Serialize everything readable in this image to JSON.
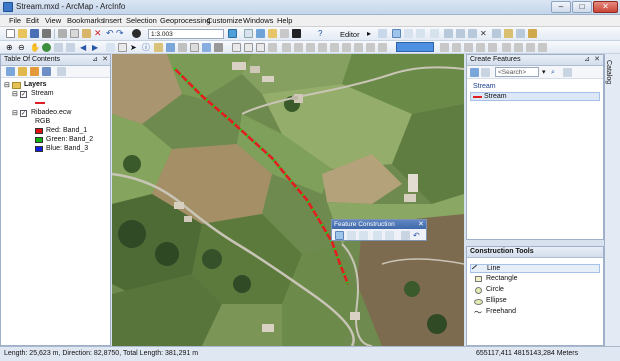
{
  "window": {
    "title": "Stream.mxd - ArcMap - ArcInfo"
  },
  "menu": {
    "items": [
      {
        "label": "File"
      },
      {
        "label": "Edit"
      },
      {
        "label": "View"
      },
      {
        "label": "Bookmarks"
      },
      {
        "label": "Insert"
      },
      {
        "label": "Selection"
      },
      {
        "label": "Geoprocessing"
      },
      {
        "label": "Customize"
      },
      {
        "label": "Windows"
      },
      {
        "label": "Help"
      }
    ]
  },
  "toolbar": {
    "scale_value": "1:3.003",
    "editor_label": "Editor"
  },
  "toc": {
    "title": "Table Of Contents",
    "layers_label": "Layers",
    "layers": [
      {
        "name": "Stream",
        "checked": true
      },
      {
        "name": "Ribadeo.ecw",
        "checked": true,
        "renderer": "RGB",
        "bands": [
          {
            "label": "Red:",
            "band": "Band_1",
            "color": "#e01010"
          },
          {
            "label": "Green:",
            "band": "Band_2",
            "color": "#10b010"
          },
          {
            "label": "Blue:",
            "band": "Band_3",
            "color": "#1020e0"
          }
        ]
      }
    ]
  },
  "create_features": {
    "title": "Create Features",
    "search_placeholder": "<Search>",
    "group_label": "Stream",
    "template_label": "Stream"
  },
  "construction_tools": {
    "title": "Construction Tools",
    "items": [
      {
        "label": "Line",
        "icon": "line-icon",
        "selected": true
      },
      {
        "label": "Rectangle",
        "icon": "rectangle-icon",
        "selected": false
      },
      {
        "label": "Circle",
        "icon": "circle-icon",
        "selected": false
      },
      {
        "label": "Ellipse",
        "icon": "ellipse-icon",
        "selected": false
      },
      {
        "label": "Freehand",
        "icon": "freehand-icon",
        "selected": false
      }
    ]
  },
  "feature_construction": {
    "title": "Feature Construction"
  },
  "catalog_tab": {
    "label": "Catalog"
  },
  "status": {
    "message": "Length: 25,623 m, Direction: 82,8750, Total Length: 381,291 m",
    "coordinates": "655117,411  4815143,284 Meters"
  },
  "colors": {
    "stream_line": "#e02020",
    "stream_vertex": "#22cc22",
    "accent": "#3f69aa"
  }
}
